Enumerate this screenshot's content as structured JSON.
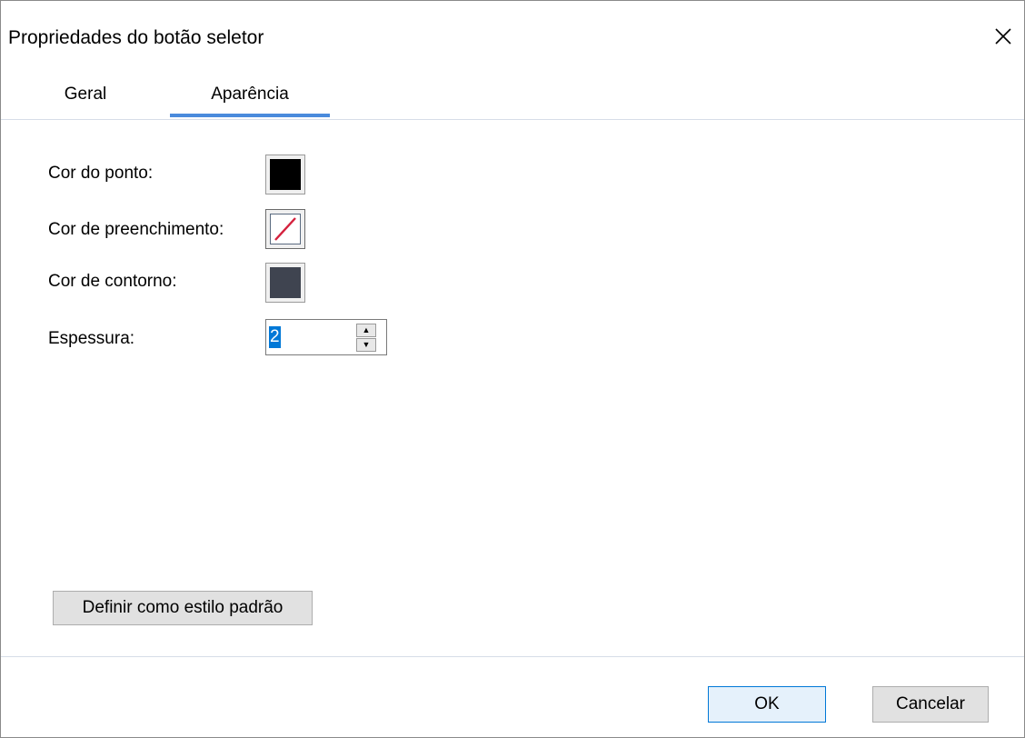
{
  "window": {
    "title": "Propriedades do botão seletor",
    "close_icon": "close-icon"
  },
  "tabs": [
    {
      "label": "Geral",
      "selected": false
    },
    {
      "label": "Aparência",
      "selected": true
    }
  ],
  "appearance": {
    "dot_color": {
      "label": "Cor do ponto:",
      "color": "#000000"
    },
    "fill_color": {
      "label": "Cor de preenchimento:",
      "color": "none",
      "icon": "no-color-icon"
    },
    "border_color": {
      "label": "Cor de contorno:",
      "color": "#3f4450"
    },
    "thickness": {
      "label": "Espessura:",
      "value": "2"
    }
  },
  "buttons": {
    "set_default_style": "Definir como estilo padrão",
    "ok": "OK",
    "cancel": "Cancelar"
  },
  "colors": {
    "accent": "#4a8bdc",
    "selection": "#0078d7",
    "no_color_slash": "#d4213d"
  }
}
